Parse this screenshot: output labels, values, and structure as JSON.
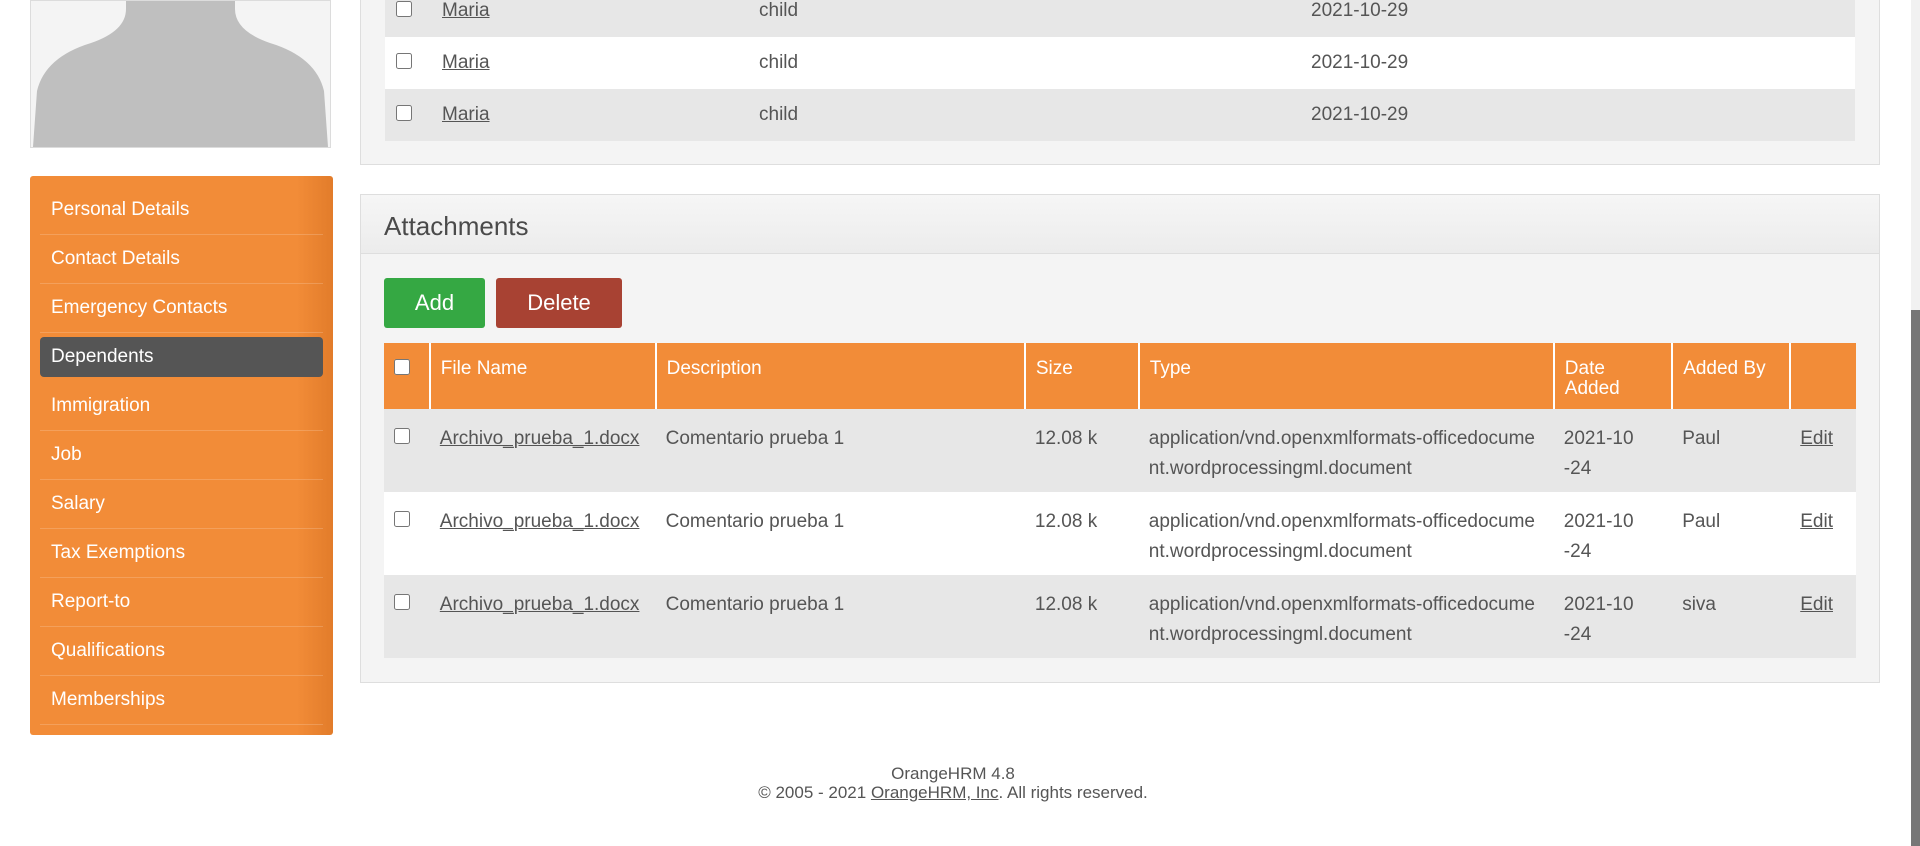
{
  "sidebar": {
    "items": [
      {
        "label": "Personal Details",
        "active": false
      },
      {
        "label": "Contact Details",
        "active": false
      },
      {
        "label": "Emergency Contacts",
        "active": false
      },
      {
        "label": "Dependents",
        "active": true
      },
      {
        "label": "Immigration",
        "active": false
      },
      {
        "label": "Job",
        "active": false
      },
      {
        "label": "Salary",
        "active": false
      },
      {
        "label": "Tax Exemptions",
        "active": false
      },
      {
        "label": "Report-to",
        "active": false
      },
      {
        "label": "Qualifications",
        "active": false
      },
      {
        "label": "Memberships",
        "active": false
      }
    ]
  },
  "dependents": {
    "rows": [
      {
        "name": "Maria",
        "relationship": "child",
        "dob": "2021-10-29"
      },
      {
        "name": "Maria",
        "relationship": "child",
        "dob": "2021-10-29"
      },
      {
        "name": "Maria",
        "relationship": "child",
        "dob": "2021-10-29"
      }
    ]
  },
  "attachments": {
    "title": "Attachments",
    "add_label": "Add",
    "delete_label": "Delete",
    "columns": [
      "File Name",
      "Description",
      "Size",
      "Type",
      "Date Added",
      "Added By",
      ""
    ],
    "rows": [
      {
        "file": "Archivo_prueba_1.docx",
        "description": "Comentario prueba 1",
        "size": "12.08 k",
        "type": "application/vnd.openxmlformats-officedocument.wordprocessingml.document",
        "date": "2021-10-24",
        "added_by": "Paul",
        "action": "Edit"
      },
      {
        "file": "Archivo_prueba_1.docx",
        "description": "Comentario prueba 1",
        "size": "12.08 k",
        "type": "application/vnd.openxmlformats-officedocument.wordprocessingml.document",
        "date": "2021-10-24",
        "added_by": "Paul",
        "action": "Edit"
      },
      {
        "file": "Archivo_prueba_1.docx",
        "description": "Comentario prueba 1",
        "size": "12.08 k",
        "type": "application/vnd.openxmlformats-officedocument.wordprocessingml.document",
        "date": "2021-10-24",
        "added_by": "siva",
        "action": "Edit"
      }
    ]
  },
  "footer": {
    "version": "OrangeHRM 4.8",
    "copyright_prefix": "© 2005 - 2021 ",
    "company_link": "OrangeHRM, Inc",
    "copyright_suffix": ". All rights reserved."
  },
  "colors": {
    "accent": "#f28c38",
    "add": "#35a843",
    "delete": "#a84233",
    "active_nav": "#555555"
  }
}
